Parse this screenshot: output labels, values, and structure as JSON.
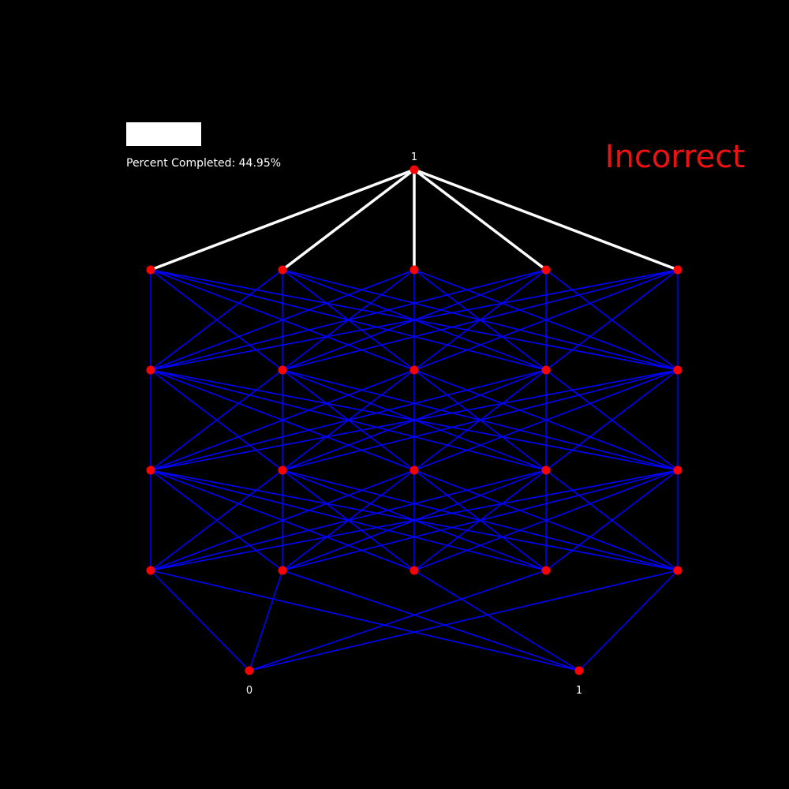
{
  "status": {
    "progress_text": "Percent Completed: 44.95%",
    "progress_fraction": 0.4495,
    "verdict": "Incorrect",
    "verdict_color": "#ee1111"
  },
  "graph": {
    "background_color": "#000000",
    "node_color": "#ff0000",
    "edge_color": "#0000ff",
    "path_color": "#ffffff",
    "top_node_label": "1",
    "bottom_labels": [
      "0",
      "1"
    ],
    "layers": 5,
    "nodes_per_layer": 5
  }
}
